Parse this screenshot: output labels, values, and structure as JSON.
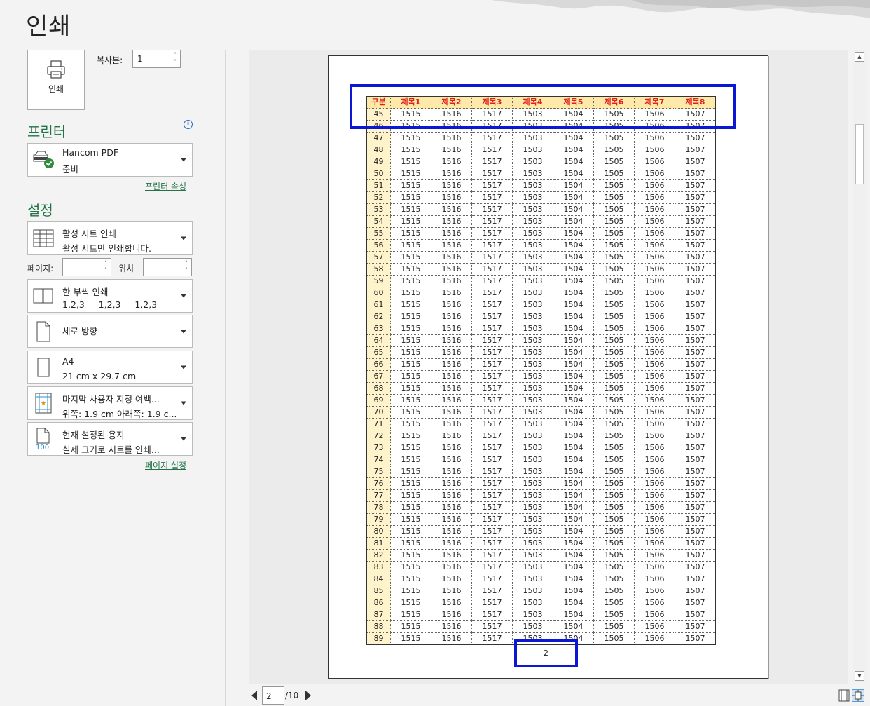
{
  "title": "인쇄",
  "print_button": {
    "label": "인쇄",
    "icon": "printer-icon"
  },
  "copies": {
    "label": "복사본:",
    "value": "1"
  },
  "printer_section": {
    "heading": "프린터",
    "printer_name": "Hancom PDF",
    "status": "준비",
    "properties_link": "프린터 속성"
  },
  "settings_section": {
    "heading": "설정",
    "what_to_print": {
      "title": "활성 시트 인쇄",
      "subtitle": "활성 시트만 인쇄합니다."
    },
    "pages_label": "페이지:",
    "pages_from": "",
    "pages_to_label": "위치",
    "pages_to": "",
    "collation": {
      "title": "한 부씩 인쇄",
      "subtitle": "1,2,3     1,2,3     1,2,3"
    },
    "orientation": {
      "title": "세로 방향"
    },
    "paper": {
      "title": "A4",
      "subtitle": "21 cm x 29.7 cm"
    },
    "margins": {
      "title": "마지막 사용자 지정 여백...",
      "subtitle": "위쪽: 1.9 cm 아래쪽: 1.9 c..."
    },
    "scaling": {
      "title": "현재 설정된 용지",
      "subtitle": "실제 크기로 시트를 인쇄...",
      "icon_text": "100"
    },
    "page_setup_link": "페이지 설정"
  },
  "preview": {
    "sheet": {
      "headers": [
        "구분",
        "제목1",
        "제목2",
        "제목3",
        "제목4",
        "제목5",
        "제목6",
        "제목7",
        "제목8"
      ],
      "row_start": 45,
      "row_end": 89,
      "row_values": [
        "1515",
        "1516",
        "1517",
        "1503",
        "1504",
        "1505",
        "1506",
        "1507"
      ]
    },
    "footer_page_number": "2"
  },
  "navigation": {
    "current_page": "2",
    "total_pages": "/10"
  },
  "colors": {
    "accent_green": "#217346",
    "highlight_blue": "#0a18d6",
    "header_text_red": "#e0201c",
    "header_fill": "#ffe9a8"
  }
}
